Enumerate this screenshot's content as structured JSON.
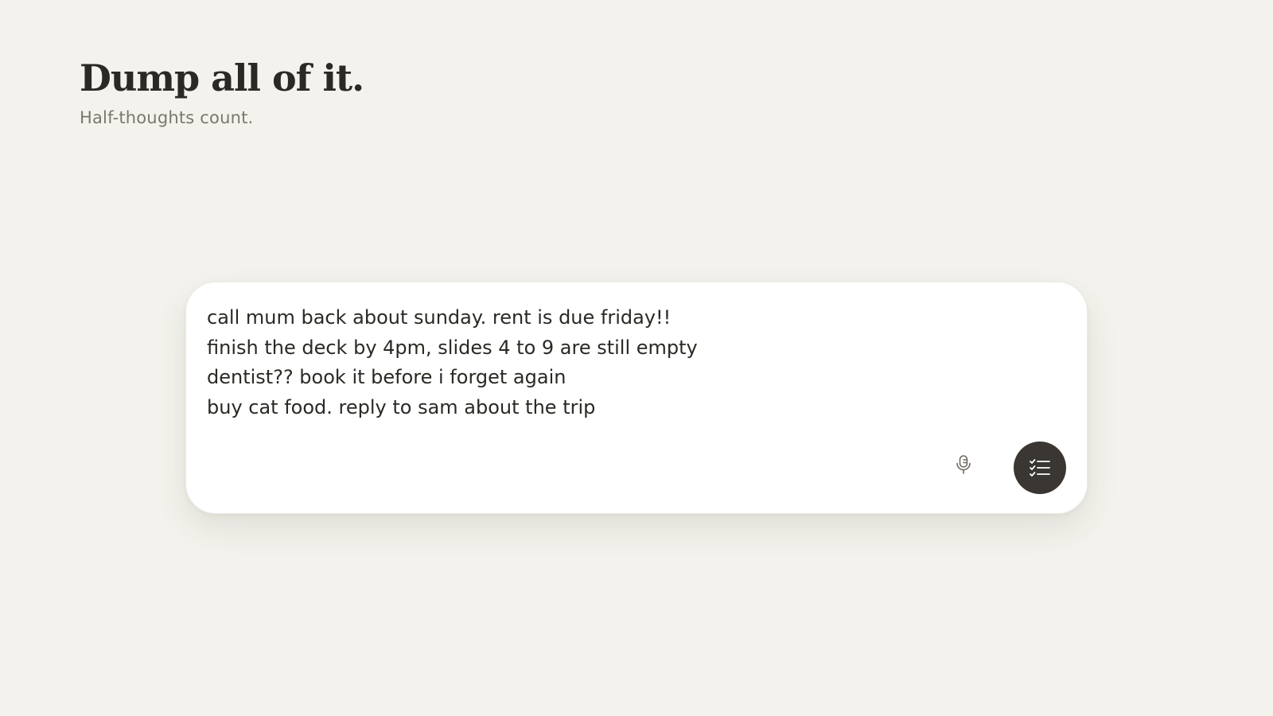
{
  "header": {
    "title": "Dump all of it.",
    "subtitle": "Half-thoughts count."
  },
  "input": {
    "value": "call mum back about sunday. rent is due friday!!\nfinish the deck by 4pm, slides 4 to 9 are still empty\ndentist?? book it before i forget again\nbuy cat food. reply to sam about the trip",
    "placeholder": ""
  },
  "icons": {
    "mic": "microphone-icon",
    "organize": "checklist-icon"
  },
  "colors": {
    "background": "#f3f2ec",
    "card": "#ffffff",
    "text": "#2b2924",
    "muted": "#7a776f",
    "button": "#3a3631"
  }
}
